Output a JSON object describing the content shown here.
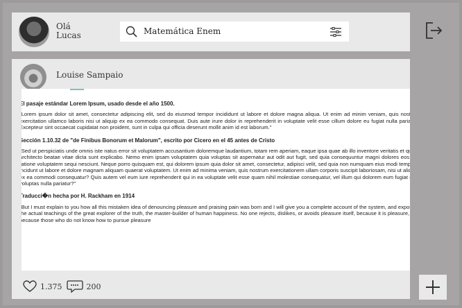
{
  "header": {
    "greeting": "Olá",
    "user_name": "Lucas",
    "search_value": "Matemática Enem"
  },
  "post": {
    "author": "Louise Sampaio",
    "likes": "1.375",
    "comments": "200",
    "content": {
      "h1": "El pasaje estándar Lorem Ipsum, usado desde el año 1500.",
      "p1": "\"Lorem ipsum dolor sit amet, consectetur adipiscing elit, sed do eiusmod tempor incididunt ut labore et dolore magna aliqua. Ut enim ad minim veniam, quis nostrud exercitation ullamco laboris nisi ut aliquip ex ea commodo consequat. Duis aute irure dolor in reprehenderit in voluptate velit esse cillum dolore eu fugiat nulla pariatur. Excepteur sint occaecat cupidatat non proident, sunt in culpa qui officia deserunt mollit anim id est laborum.\"",
      "h2": "Sección 1.10.32 de \"de Finibus Bonorum et Malorum\", escrito por Cicero en el 45 antes de Cristo",
      "p2": "\"Sed ut perspiciatis unde omnis iste natus error sit voluptatem accusantium doloremque laudantium, totam rem aperiam, eaque ipsa quae ab illo inventore veritatis et quasi architecto beatae vitae dicta sunt explicabo. Nemo enim ipsam voluptatem quia voluptas sit aspernatur aut odit aut fugit, sed quia consequuntur magni dolores eos qui ratione voluptatem sequi nesciunt. Neque porro quisquam est, qui dolorem ipsum quia dolor sit amet, consectetur, adipisci velit, sed quia non numquam eius modi tempora incidunt ut labore et dolore magnam aliquam quaerat voluptatem. Ut enim ad minima veniam, quis nostrum exercitationem ullam corporis suscipit laboriosam, nisi ut aliquid ex ea commodi consequatur? Quis autem vel eum iure reprehenderit qui in ea voluptate velit esse quam nihil molestiae consequatur, vel illum qui dolorem eum fugiat quo voluptas nulla pariatur?\"",
      "h3": "Traducci�n hecha por H. Rackham en 1914",
      "p3": "\"But I must explain to you how all this mistaken idea of denouncing pleasure and praising pain was born and I will give you a complete account of the system, and expound the actual teachings of the great explorer of the truth, the master-builder of human happiness. No one rejects, dislikes, or avoids pleasure itself, because it is pleasure, but because those who do not know how to pursue pleasure"
    }
  },
  "icons": {
    "search": "search-icon",
    "filter": "filter-icon",
    "logout": "logout-icon",
    "like": "heart-icon",
    "comment": "comment-icon",
    "add": "plus-icon"
  }
}
